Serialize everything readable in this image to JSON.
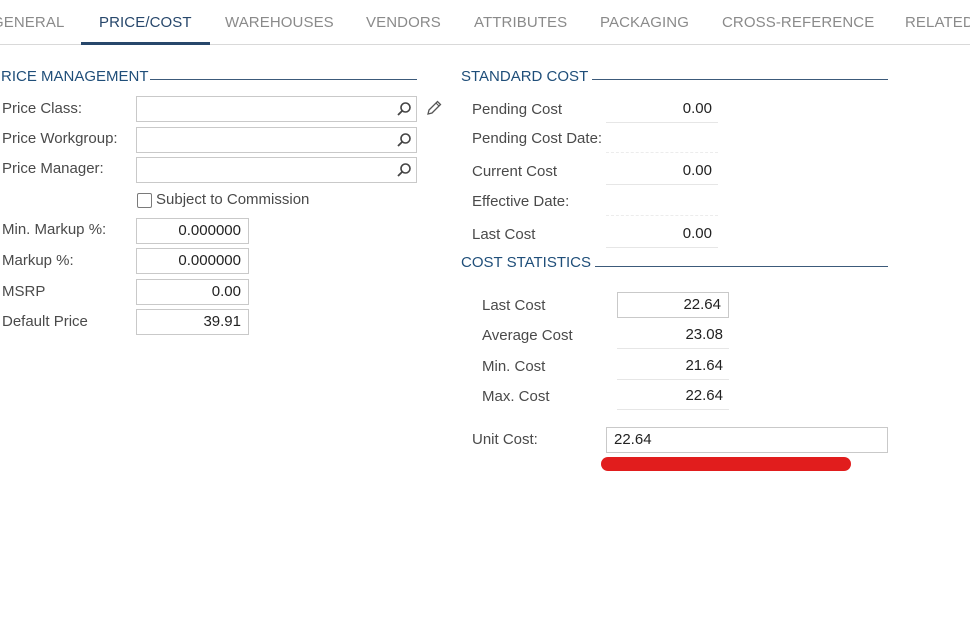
{
  "tabs": [
    "GENERAL",
    "PRICE/COST",
    "WAREHOUSES",
    "VENDORS",
    "ATTRIBUTES",
    "PACKAGING",
    "CROSS-REFERENCE",
    "RELATED"
  ],
  "active_tab": "PRICE/COST",
  "price_management": {
    "title": "RICE MANAGEMENT",
    "price_class_label": "Price Class:",
    "price_workgroup_label": "Price Workgroup:",
    "price_manager_label": "Price Manager:",
    "subject_to_commission_label": "Subject to Commission",
    "subject_to_commission_checked": false,
    "min_markup_label": "Min. Markup %:",
    "min_markup_value": "0.000000",
    "markup_label": "Markup %:",
    "markup_value": "0.000000",
    "msrp_label": "MSRP",
    "msrp_value": "0.00",
    "default_price_label": "Default Price",
    "default_price_value": "39.91"
  },
  "standard_cost": {
    "title": "STANDARD COST",
    "pending_cost_label": "Pending Cost",
    "pending_cost_value": "0.00",
    "pending_cost_date_label": "Pending Cost Date:",
    "current_cost_label": "Current Cost",
    "current_cost_value": "0.00",
    "effective_date_label": "Effective Date:",
    "last_cost_label": "Last Cost",
    "last_cost_value": "0.00"
  },
  "cost_statistics": {
    "title": "COST STATISTICS",
    "last_cost_label": "Last Cost",
    "last_cost_value": "22.64",
    "average_cost_label": "Average Cost",
    "average_cost_value": "23.08",
    "min_cost_label": "Min. Cost",
    "min_cost_value": "21.64",
    "max_cost_label": "Max. Cost",
    "max_cost_value": "22.64",
    "unit_cost_label": "Unit Cost:",
    "unit_cost_value": "22.64"
  },
  "colors": {
    "accent": "#27476b",
    "highlight_mark": "#e11d1d"
  },
  "icons": [
    "search-icon",
    "pencil-icon",
    "checkbox"
  ]
}
